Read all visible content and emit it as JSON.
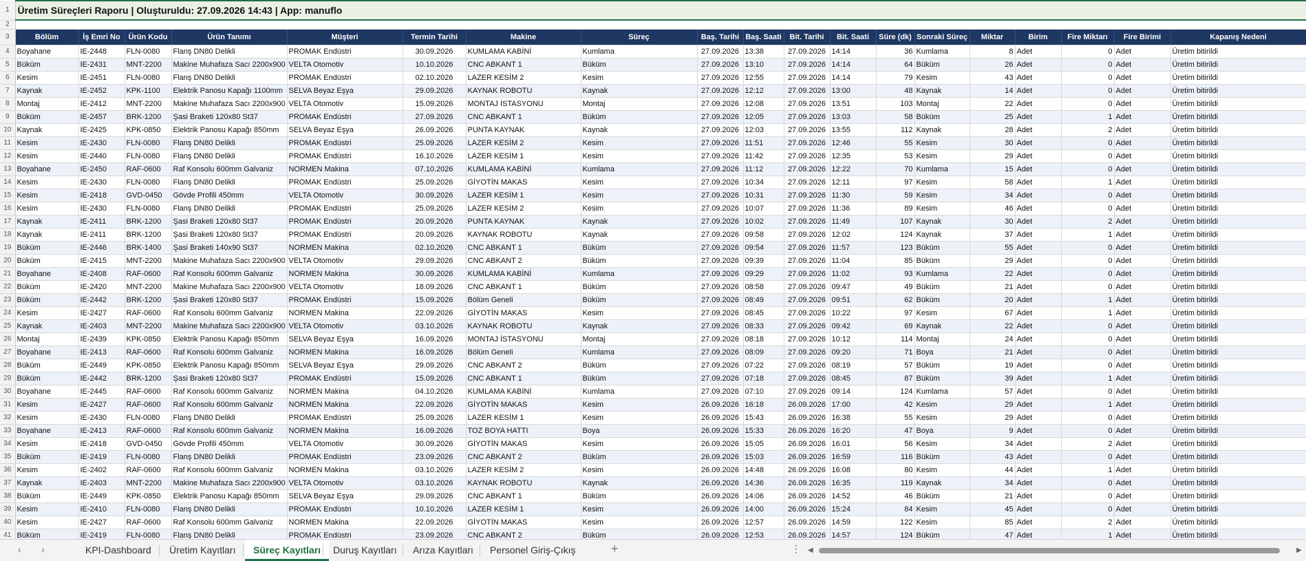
{
  "title": "Üretim Süreçleri Raporu  |  Oluşturuldu: 27.09.2026 14:43  |  App: manuflo",
  "columns": [
    "Bölüm",
    "İş Emri No",
    "Ürün Kodu",
    "Ürün Tanımı",
    "Müşteri",
    "Termin Tarihi",
    "Makine",
    "Süreç",
    "Baş. Tarihi",
    "Baş. Saati",
    "Bit. Tarihi",
    "Bit. Saati",
    "Süre (dk)",
    "Sonraki Süreç",
    "Miktar",
    "Birim",
    "Fire Miktarı",
    "Fire Birimi",
    "Kapanış Nedeni"
  ],
  "rows": [
    [
      "Boyahane",
      "IE-2448",
      "FLN-0080",
      "Flanş DN80 Delikli",
      "PROMAK Endüstri",
      "30.09.2026",
      "KUMLAMA KABİNİ",
      "Kumlama",
      "27.09.2026",
      "13:38",
      "27.09.2026",
      "14:14",
      "36",
      "Kumlama",
      "8",
      "Adet",
      "0",
      "Adet",
      "Üretim bitirildi"
    ],
    [
      "Büküm",
      "IE-2431",
      "MNT-2200",
      "Makine Muhafaza Sacı 2200x900",
      "VELTA Otomotiv",
      "10.10.2026",
      "CNC ABKANT 1",
      "Büküm",
      "27.09.2026",
      "13:10",
      "27.09.2026",
      "14:14",
      "64",
      "Büküm",
      "26",
      "Adet",
      "0",
      "Adet",
      "Üretim bitirildi"
    ],
    [
      "Kesim",
      "IE-2451",
      "FLN-0080",
      "Flanş DN80 Delikli",
      "PROMAK Endüstri",
      "02.10.2026",
      "LAZER KESİM 2",
      "Kesim",
      "27.09.2026",
      "12:55",
      "27.09.2026",
      "14:14",
      "79",
      "Kesim",
      "43",
      "Adet",
      "0",
      "Adet",
      "Üretim bitirildi"
    ],
    [
      "Kaynak",
      "IE-2452",
      "KPK-1100",
      "Elektrik Panosu Kapağı 1100mm",
      "SELVA Beyaz Eşya",
      "29.09.2026",
      "KAYNAK ROBOTU",
      "Kaynak",
      "27.09.2026",
      "12:12",
      "27.09.2026",
      "13:00",
      "48",
      "Kaynak",
      "14",
      "Adet",
      "0",
      "Adet",
      "Üretim bitirildi"
    ],
    [
      "Montaj",
      "IE-2412",
      "MNT-2200",
      "Makine Muhafaza Sacı 2200x900",
      "VELTA Otomotiv",
      "15.09.2026",
      "MONTAJ İSTASYONU",
      "Montaj",
      "27.09.2026",
      "12:08",
      "27.09.2026",
      "13:51",
      "103",
      "Montaj",
      "22",
      "Adet",
      "0",
      "Adet",
      "Üretim bitirildi"
    ],
    [
      "Büküm",
      "IE-2457",
      "BRK-1200",
      "Şasi Braketi 120x80 St37",
      "PROMAK Endüstri",
      "27.09.2026",
      "CNC ABKANT 1",
      "Büküm",
      "27.09.2026",
      "12:05",
      "27.09.2026",
      "13:03",
      "58",
      "Büküm",
      "25",
      "Adet",
      "1",
      "Adet",
      "Üretim bitirildi"
    ],
    [
      "Kaynak",
      "IE-2425",
      "KPK-0850",
      "Elektrik Panosu Kapağı 850mm",
      "SELVA Beyaz Eşya",
      "26.09.2026",
      "PUNTA KAYNAK",
      "Kaynak",
      "27.09.2026",
      "12:03",
      "27.09.2026",
      "13:55",
      "112",
      "Kaynak",
      "28",
      "Adet",
      "2",
      "Adet",
      "Üretim bitirildi"
    ],
    [
      "Kesim",
      "IE-2430",
      "FLN-0080",
      "Flanş DN80 Delikli",
      "PROMAK Endüstri",
      "25.09.2026",
      "LAZER KESİM 2",
      "Kesim",
      "27.09.2026",
      "11:51",
      "27.09.2026",
      "12:46",
      "55",
      "Kesim",
      "30",
      "Adet",
      "0",
      "Adet",
      "Üretim bitirildi"
    ],
    [
      "Kesim",
      "IE-2440",
      "FLN-0080",
      "Flanş DN80 Delikli",
      "PROMAK Endüstri",
      "16.10.2026",
      "LAZER KESİM 1",
      "Kesim",
      "27.09.2026",
      "11:42",
      "27.09.2026",
      "12:35",
      "53",
      "Kesim",
      "29",
      "Adet",
      "0",
      "Adet",
      "Üretim bitirildi"
    ],
    [
      "Boyahane",
      "IE-2450",
      "RAF-0600",
      "Raf Konsolu 600mm Galvaniz",
      "NORMEN Makina",
      "07.10.2026",
      "KUMLAMA KABİNİ",
      "Kumlama",
      "27.09.2026",
      "11:12",
      "27.09.2026",
      "12:22",
      "70",
      "Kumlama",
      "15",
      "Adet",
      "0",
      "Adet",
      "Üretim bitirildi"
    ],
    [
      "Kesim",
      "IE-2430",
      "FLN-0080",
      "Flanş DN80 Delikli",
      "PROMAK Endüstri",
      "25.09.2026",
      "GİYOTİN MAKAS",
      "Kesim",
      "27.09.2026",
      "10:34",
      "27.09.2026",
      "12:11",
      "97",
      "Kesim",
      "58",
      "Adet",
      "1",
      "Adet",
      "Üretim bitirildi"
    ],
    [
      "Kesim",
      "IE-2418",
      "GVD-0450",
      "Gövde Profili 450mm",
      "VELTA Otomotiv",
      "30.09.2026",
      "LAZER KESİM 1",
      "Kesim",
      "27.09.2026",
      "10:31",
      "27.09.2026",
      "11:30",
      "59",
      "Kesim",
      "34",
      "Adet",
      "0",
      "Adet",
      "Üretim bitirildi"
    ],
    [
      "Kesim",
      "IE-2430",
      "FLN-0080",
      "Flanş DN80 Delikli",
      "PROMAK Endüstri",
      "25.09.2026",
      "LAZER KESİM 2",
      "Kesim",
      "27.09.2026",
      "10:07",
      "27.09.2026",
      "11:36",
      "89",
      "Kesim",
      "46",
      "Adet",
      "0",
      "Adet",
      "Üretim bitirildi"
    ],
    [
      "Kaynak",
      "IE-2411",
      "BRK-1200",
      "Şasi Braketi 120x80 St37",
      "PROMAK Endüstri",
      "20.09.2026",
      "PUNTA KAYNAK",
      "Kaynak",
      "27.09.2026",
      "10:02",
      "27.09.2026",
      "11:49",
      "107",
      "Kaynak",
      "30",
      "Adet",
      "2",
      "Adet",
      "Üretim bitirildi"
    ],
    [
      "Kaynak",
      "IE-2411",
      "BRK-1200",
      "Şasi Braketi 120x80 St37",
      "PROMAK Endüstri",
      "20.09.2026",
      "KAYNAK ROBOTU",
      "Kaynak",
      "27.09.2026",
      "09:58",
      "27.09.2026",
      "12:02",
      "124",
      "Kaynak",
      "37",
      "Adet",
      "1",
      "Adet",
      "Üretim bitirildi"
    ],
    [
      "Büküm",
      "IE-2446",
      "BRK-1400",
      "Şasi Braketi 140x90 St37",
      "NORMEN Makina",
      "02.10.2026",
      "CNC ABKANT 1",
      "Büküm",
      "27.09.2026",
      "09:54",
      "27.09.2026",
      "11:57",
      "123",
      "Büküm",
      "55",
      "Adet",
      "0",
      "Adet",
      "Üretim bitirildi"
    ],
    [
      "Büküm",
      "IE-2415",
      "MNT-2200",
      "Makine Muhafaza Sacı 2200x900",
      "VELTA Otomotiv",
      "29.09.2026",
      "CNC ABKANT 2",
      "Büküm",
      "27.09.2026",
      "09:39",
      "27.09.2026",
      "11:04",
      "85",
      "Büküm",
      "29",
      "Adet",
      "0",
      "Adet",
      "Üretim bitirildi"
    ],
    [
      "Boyahane",
      "IE-2408",
      "RAF-0600",
      "Raf Konsolu 600mm Galvaniz",
      "NORMEN Makina",
      "30.09.2026",
      "KUMLAMA KABİNİ",
      "Kumlama",
      "27.09.2026",
      "09:29",
      "27.09.2026",
      "11:02",
      "93",
      "Kumlama",
      "22",
      "Adet",
      "0",
      "Adet",
      "Üretim bitirildi"
    ],
    [
      "Büküm",
      "IE-2420",
      "MNT-2200",
      "Makine Muhafaza Sacı 2200x900",
      "VELTA Otomotiv",
      "18.09.2026",
      "CNC ABKANT 1",
      "Büküm",
      "27.09.2026",
      "08:58",
      "27.09.2026",
      "09:47",
      "49",
      "Büküm",
      "21",
      "Adet",
      "0",
      "Adet",
      "Üretim bitirildi"
    ],
    [
      "Büküm",
      "IE-2442",
      "BRK-1200",
      "Şasi Braketi 120x80 St37",
      "PROMAK Endüstri",
      "15.09.2026",
      "Bölüm Geneli",
      "Büküm",
      "27.09.2026",
      "08:49",
      "27.09.2026",
      "09:51",
      "62",
      "Büküm",
      "20",
      "Adet",
      "1",
      "Adet",
      "Üretim bitirildi"
    ],
    [
      "Kesim",
      "IE-2427",
      "RAF-0600",
      "Raf Konsolu 600mm Galvaniz",
      "NORMEN Makina",
      "22.09.2026",
      "GİYOTİN MAKAS",
      "Kesim",
      "27.09.2026",
      "08:45",
      "27.09.2026",
      "10:22",
      "97",
      "Kesim",
      "67",
      "Adet",
      "1",
      "Adet",
      "Üretim bitirildi"
    ],
    [
      "Kaynak",
      "IE-2403",
      "MNT-2200",
      "Makine Muhafaza Sacı 2200x900",
      "VELTA Otomotiv",
      "03.10.2026",
      "KAYNAK ROBOTU",
      "Kaynak",
      "27.09.2026",
      "08:33",
      "27.09.2026",
      "09:42",
      "69",
      "Kaynak",
      "22",
      "Adet",
      "0",
      "Adet",
      "Üretim bitirildi"
    ],
    [
      "Montaj",
      "IE-2439",
      "KPK-0850",
      "Elektrik Panosu Kapağı 850mm",
      "SELVA Beyaz Eşya",
      "16.09.2026",
      "MONTAJ İSTASYONU",
      "Montaj",
      "27.09.2026",
      "08:18",
      "27.09.2026",
      "10:12",
      "114",
      "Montaj",
      "24",
      "Adet",
      "0",
      "Adet",
      "Üretim bitirildi"
    ],
    [
      "Boyahane",
      "IE-2413",
      "RAF-0600",
      "Raf Konsolu 600mm Galvaniz",
      "NORMEN Makina",
      "16.09.2026",
      "Bölüm Geneli",
      "Kumlama",
      "27.09.2026",
      "08:09",
      "27.09.2026",
      "09:20",
      "71",
      "Boya",
      "21",
      "Adet",
      "0",
      "Adet",
      "Üretim bitirildi"
    ],
    [
      "Büküm",
      "IE-2449",
      "KPK-0850",
      "Elektrik Panosu Kapağı 850mm",
      "SELVA Beyaz Eşya",
      "29.09.2026",
      "CNC ABKANT 2",
      "Büküm",
      "27.09.2026",
      "07:22",
      "27.09.2026",
      "08:19",
      "57",
      "Büküm",
      "19",
      "Adet",
      "0",
      "Adet",
      "Üretim bitirildi"
    ],
    [
      "Büküm",
      "IE-2442",
      "BRK-1200",
      "Şasi Braketi 120x80 St37",
      "PROMAK Endüstri",
      "15.09.2026",
      "CNC ABKANT 1",
      "Büküm",
      "27.09.2026",
      "07:18",
      "27.09.2026",
      "08:45",
      "87",
      "Büküm",
      "39",
      "Adet",
      "1",
      "Adet",
      "Üretim bitirildi"
    ],
    [
      "Boyahane",
      "IE-2445",
      "RAF-0600",
      "Raf Konsolu 600mm Galvaniz",
      "NORMEN Makina",
      "04.10.2026",
      "KUMLAMA KABİNİ",
      "Kumlama",
      "27.09.2026",
      "07:10",
      "27.09.2026",
      "09:14",
      "124",
      "Kumlama",
      "57",
      "Adet",
      "0",
      "Adet",
      "Üretim bitirildi"
    ],
    [
      "Kesim",
      "IE-2427",
      "RAF-0600",
      "Raf Konsolu 600mm Galvaniz",
      "NORMEN Makina",
      "22.09.2026",
      "GİYOTİN MAKAS",
      "Kesim",
      "26.09.2026",
      "16:18",
      "26.09.2026",
      "17:00",
      "42",
      "Kesim",
      "29",
      "Adet",
      "1",
      "Adet",
      "Üretim bitirildi"
    ],
    [
      "Kesim",
      "IE-2430",
      "FLN-0080",
      "Flanş DN80 Delikli",
      "PROMAK Endüstri",
      "25.09.2026",
      "LAZER KESİM 1",
      "Kesim",
      "26.09.2026",
      "15:43",
      "26.09.2026",
      "16:38",
      "55",
      "Kesim",
      "29",
      "Adet",
      "0",
      "Adet",
      "Üretim bitirildi"
    ],
    [
      "Boyahane",
      "IE-2413",
      "RAF-0600",
      "Raf Konsolu 600mm Galvaniz",
      "NORMEN Makina",
      "16.09.2026",
      "TOZ BOYA HATTI",
      "Boya",
      "26.09.2026",
      "15:33",
      "26.09.2026",
      "16:20",
      "47",
      "Boya",
      "9",
      "Adet",
      "0",
      "Adet",
      "Üretim bitirildi"
    ],
    [
      "Kesim",
      "IE-2418",
      "GVD-0450",
      "Gövde Profili 450mm",
      "VELTA Otomotiv",
      "30.09.2026",
      "GİYOTİN MAKAS",
      "Kesim",
      "26.09.2026",
      "15:05",
      "26.09.2026",
      "16:01",
      "56",
      "Kesim",
      "34",
      "Adet",
      "2",
      "Adet",
      "Üretim bitirildi"
    ],
    [
      "Büküm",
      "IE-2419",
      "FLN-0080",
      "Flanş DN80 Delikli",
      "PROMAK Endüstri",
      "23.09.2026",
      "CNC ABKANT 2",
      "Büküm",
      "26.09.2026",
      "15:03",
      "26.09.2026",
      "16:59",
      "116",
      "Büküm",
      "43",
      "Adet",
      "0",
      "Adet",
      "Üretim bitirildi"
    ],
    [
      "Kesim",
      "IE-2402",
      "RAF-0600",
      "Raf Konsolu 600mm Galvaniz",
      "NORMEN Makina",
      "03.10.2026",
      "LAZER KESİM 2",
      "Kesim",
      "26.09.2026",
      "14:48",
      "26.09.2026",
      "16:08",
      "80",
      "Kesim",
      "44",
      "Adet",
      "1",
      "Adet",
      "Üretim bitirildi"
    ],
    [
      "Kaynak",
      "IE-2403",
      "MNT-2200",
      "Makine Muhafaza Sacı 2200x900",
      "VELTA Otomotiv",
      "03.10.2026",
      "KAYNAK ROBOTU",
      "Kaynak",
      "26.09.2026",
      "14:36",
      "26.09.2026",
      "16:35",
      "119",
      "Kaynak",
      "34",
      "Adet",
      "0",
      "Adet",
      "Üretim bitirildi"
    ],
    [
      "Büküm",
      "IE-2449",
      "KPK-0850",
      "Elektrik Panosu Kapağı 850mm",
      "SELVA Beyaz Eşya",
      "29.09.2026",
      "CNC ABKANT 1",
      "Büküm",
      "26.09.2026",
      "14:06",
      "26.09.2026",
      "14:52",
      "46",
      "Büküm",
      "21",
      "Adet",
      "0",
      "Adet",
      "Üretim bitirildi"
    ],
    [
      "Kesim",
      "IE-2410",
      "FLN-0080",
      "Flanş DN80 Delikli",
      "PROMAK Endüstri",
      "10.10.2026",
      "LAZER KESİM 1",
      "Kesim",
      "26.09.2026",
      "14:00",
      "26.09.2026",
      "15:24",
      "84",
      "Kesim",
      "45",
      "Adet",
      "0",
      "Adet",
      "Üretim bitirildi"
    ],
    [
      "Kesim",
      "IE-2427",
      "RAF-0600",
      "Raf Konsolu 600mm Galvaniz",
      "NORMEN Makina",
      "22.09.2026",
      "GİYOTİN MAKAS",
      "Kesim",
      "26.09.2026",
      "12:57",
      "26.09.2026",
      "14:59",
      "122",
      "Kesim",
      "85",
      "Adet",
      "2",
      "Adet",
      "Üretim bitirildi"
    ],
    [
      "Büküm",
      "IE-2419",
      "FLN-0080",
      "Flanş DN80 Delikli",
      "PROMAK Endüstri",
      "23.09.2026",
      "CNC ABKANT 2",
      "Büküm",
      "26.09.2026",
      "12:53",
      "26.09.2026",
      "14:57",
      "124",
      "Büküm",
      "47",
      "Adet",
      "1",
      "Adet",
      "Üretim bitirildi"
    ]
  ],
  "tabs": [
    "KPI-Dashboard",
    "Üretim Kayıtları",
    "Süreç Kayıtları",
    "Duruş Kayıtları",
    "Arıza Kayıtları",
    "Personel Giriş-Çıkış"
  ],
  "active_tab": "Süreç Kayıtları",
  "icons": {
    "prev": "chevron-left-icon",
    "next": "chevron-right-icon",
    "add": "plus-icon",
    "more": "vertical-ellipsis-icon"
  },
  "colors": {
    "header_bg": "#1f3763",
    "title_accent": "#1e7145",
    "row_stripe": "#edf2f9"
  }
}
